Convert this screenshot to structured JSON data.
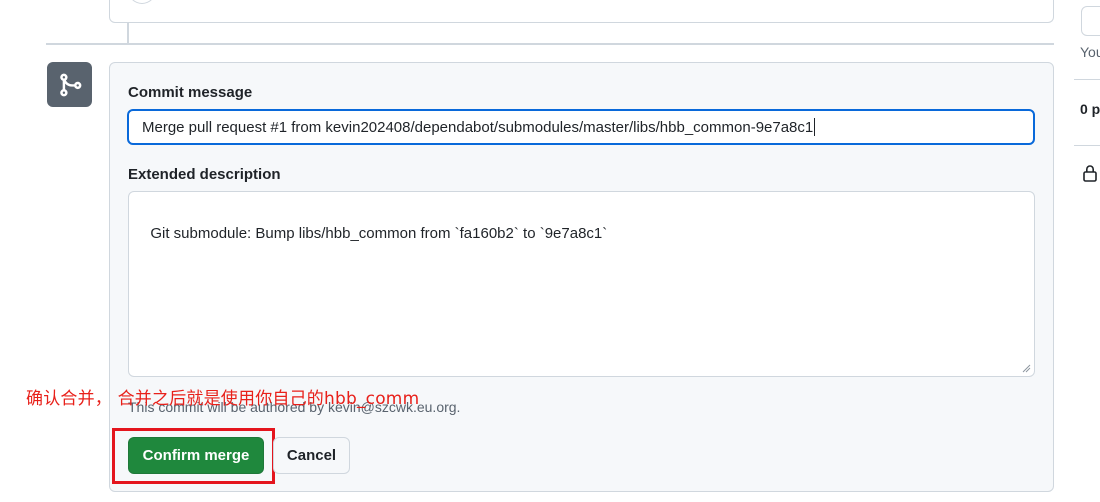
{
  "form": {
    "commit_message_label": "Commit message",
    "commit_message_value": "Merge pull request #1 from kevin202408/dependabot/submodules/master/libs/hbb_common-9e7a8c1",
    "extended_description_label": "Extended description",
    "extended_description_value": "Git submodule: Bump libs/hbb_common from `fa160b2` to `9e7a8c1`",
    "authored_note": "This commit will be authored by kevin@szcwk.eu.org.",
    "confirm_button": "Confirm merge",
    "cancel_button": "Cancel"
  },
  "annotation": {
    "text": "确认合并，  合并之后就是使用你自己的hbb_comm",
    "color": "#e8201a"
  },
  "sidebar": {
    "partial_text": "You",
    "partial_count": "0 p"
  },
  "icons": {
    "merge": "git-merge-icon",
    "lock": "lock-icon"
  },
  "colors": {
    "accent": "#0969da",
    "primary_button": "#1f883d",
    "highlight_box": "#e4151d"
  }
}
